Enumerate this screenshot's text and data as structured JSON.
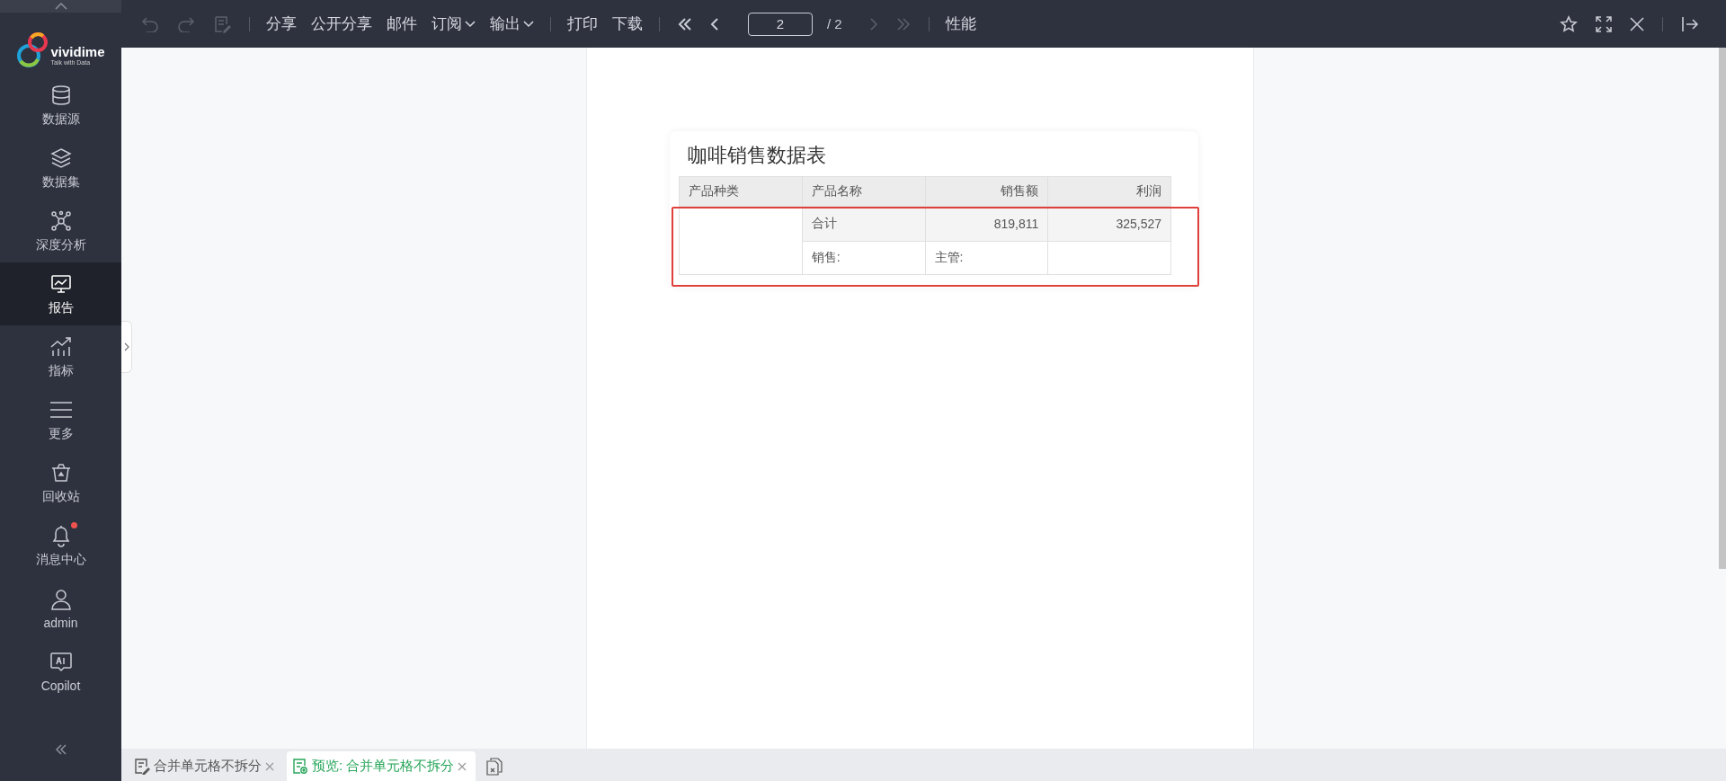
{
  "sidebar": {
    "logo": {
      "name": "vividime",
      "tagline": "Talk with Data"
    },
    "items": [
      {
        "label": "数据源",
        "selected": false,
        "badge": false
      },
      {
        "label": "数据集",
        "selected": false,
        "badge": false
      },
      {
        "label": "深度分析",
        "selected": false,
        "badge": false
      },
      {
        "label": "报告",
        "selected": true,
        "badge": false
      },
      {
        "label": "指标",
        "selected": false,
        "badge": false
      },
      {
        "label": "更多",
        "selected": false,
        "badge": false
      },
      {
        "label": "回收站",
        "selected": false,
        "badge": false
      },
      {
        "label": "消息中心",
        "selected": false,
        "badge": true
      },
      {
        "label": "admin",
        "selected": false,
        "badge": false
      },
      {
        "label": "Copilot",
        "selected": false,
        "badge": false
      }
    ]
  },
  "toolbar": {
    "history": [
      {
        "disabled": true
      },
      {
        "disabled": true
      },
      {
        "disabled": true
      }
    ],
    "actions": [
      {
        "label": "分享",
        "dropdown": false
      },
      {
        "label": "公开分享",
        "dropdown": false
      },
      {
        "label": "邮件",
        "dropdown": false
      },
      {
        "label": "订阅",
        "dropdown": true
      },
      {
        "label": "输出",
        "dropdown": true
      }
    ],
    "print_actions": [
      {
        "label": "打印"
      },
      {
        "label": "下载"
      }
    ],
    "paging": {
      "first_disabled": false,
      "prev_disabled": false,
      "page": "2",
      "total": "/ 2",
      "next_disabled": true,
      "last_disabled": true
    },
    "performance": "性能"
  },
  "report": {
    "title": "咖啡销售数据表",
    "columns": [
      {
        "label": "产品种类",
        "kind": "text"
      },
      {
        "label": "产品名称",
        "kind": "text"
      },
      {
        "label": "销售额",
        "kind": "number"
      },
      {
        "label": "利润",
        "kind": "number"
      }
    ],
    "total_row": {
      "label": "合计",
      "sales": "819,811",
      "profit": "325,527"
    },
    "footer_row": {
      "sales_label": "销售:",
      "manager_label": "主管:"
    },
    "highlighted": true
  },
  "tabs": [
    {
      "label": "合并单元格不拆分",
      "selected": false
    },
    {
      "label": "预览: 合并单元格不拆分",
      "selected": true
    }
  ]
}
